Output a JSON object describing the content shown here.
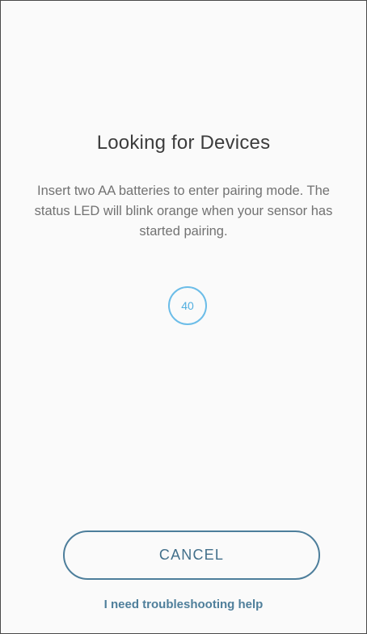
{
  "pairing": {
    "title": "Looking for Devices",
    "description": "Insert two AA batteries to enter pairing mode. The status LED will blink orange when your sensor has started pairing.",
    "countdown": "40"
  },
  "actions": {
    "cancel_label": "CANCEL",
    "help_link": "I need troubleshooting help"
  },
  "colors": {
    "accent": "#6cbde8",
    "button_border": "#4d7e9b",
    "link": "#4f7f9b"
  }
}
